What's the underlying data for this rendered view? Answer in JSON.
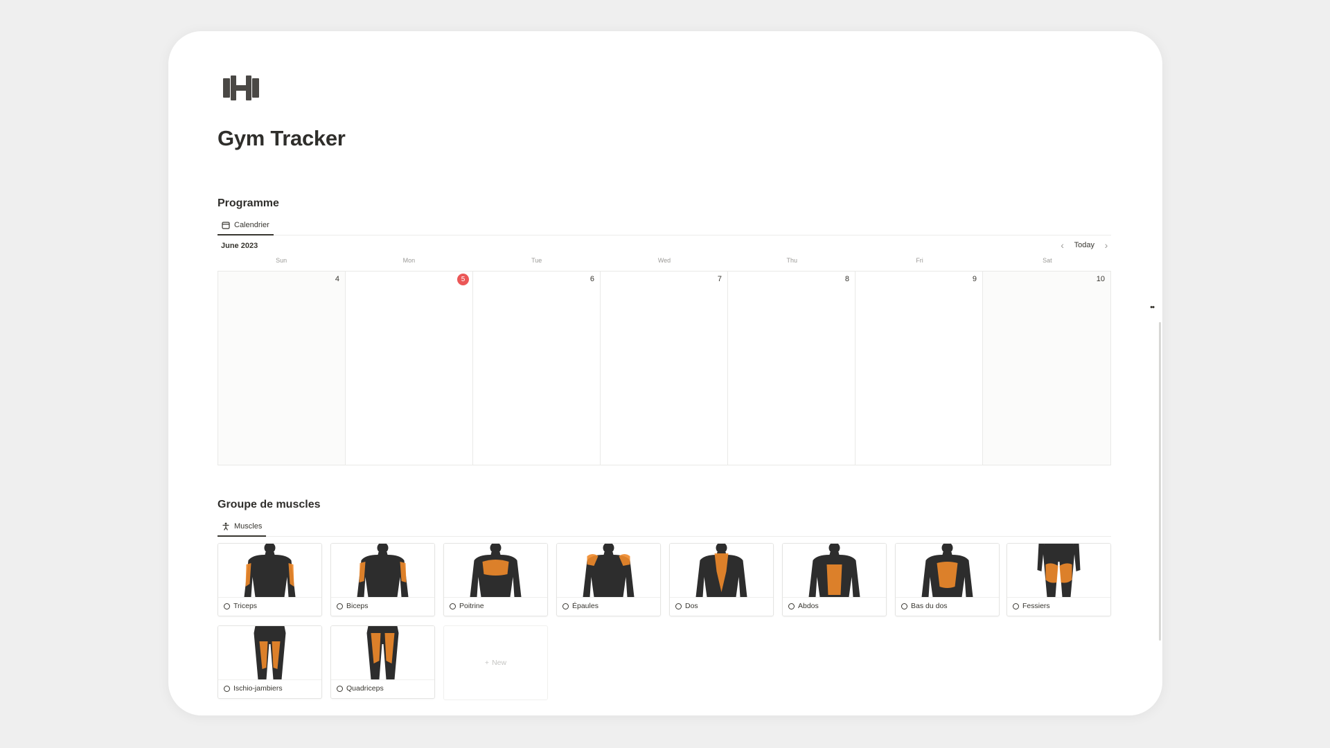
{
  "page": {
    "title": "Gym Tracker",
    "icon": "dumbbell-icon"
  },
  "programme": {
    "title": "Programme",
    "view_tab": "Calendrier",
    "calendar": {
      "month": "June 2023",
      "today_label": "Today",
      "weekdays": [
        "Sun",
        "Mon",
        "Tue",
        "Wed",
        "Thu",
        "Fri",
        "Sat"
      ],
      "days": [
        "4",
        "5",
        "6",
        "7",
        "8",
        "9",
        "10"
      ],
      "today_day": "5",
      "today_color": "#eb5757"
    }
  },
  "muscles": {
    "title": "Groupe de muscles",
    "view_tab": "Muscles",
    "items": [
      {
        "label": "Triceps",
        "highlight": "triceps"
      },
      {
        "label": "Biceps",
        "highlight": "biceps"
      },
      {
        "label": "Poitrine",
        "highlight": "chest"
      },
      {
        "label": "Épaules",
        "highlight": "shoulders"
      },
      {
        "label": "Dos",
        "highlight": "back"
      },
      {
        "label": "Abdos",
        "highlight": "abs"
      },
      {
        "label": "Bas du dos",
        "highlight": "lower-back"
      },
      {
        "label": "Fessiers",
        "highlight": "glutes"
      },
      {
        "label": "Ischio-jambiers",
        "highlight": "hamstrings"
      },
      {
        "label": "Quadriceps",
        "highlight": "quadriceps"
      }
    ],
    "new_label": "New"
  },
  "colors": {
    "accent_today": "#eb5757",
    "muscle_glow": "#f08a2a"
  }
}
